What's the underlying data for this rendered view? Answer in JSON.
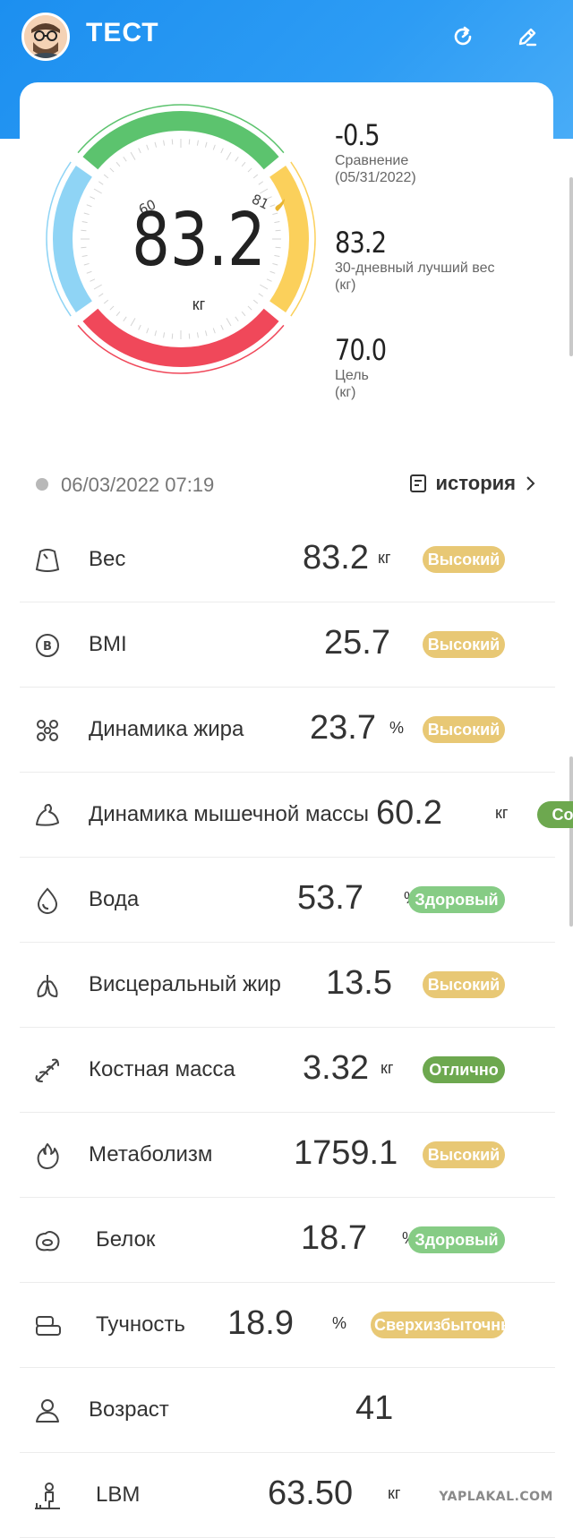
{
  "header": {
    "title": "ТЕСТ"
  },
  "gauge": {
    "weight": "83.2",
    "unit": "кг",
    "tick_low": "60",
    "tick_high": "81",
    "colors": {
      "green": "#5cc36e",
      "yellow": "#fbd05b",
      "red": "#f0485a",
      "blue": "#8fd4f5"
    }
  },
  "summary": [
    {
      "value": "-0.5",
      "label": "Сравнение",
      "sub": "(05/31/2022)"
    },
    {
      "value": "83.2",
      "label": "30-дневный лучший вес",
      "sub": "(кг)"
    },
    {
      "value": "70.0",
      "label": "Цель",
      "sub": "(кг)"
    }
  ],
  "record": {
    "datetime": "06/03/2022 07:19",
    "history_label": "история"
  },
  "metrics": [
    {
      "name": "Вес",
      "value": "83.2",
      "unit": "кг",
      "status": "Высокий",
      "status_color": "#e8c875",
      "icon": "scale-icon"
    },
    {
      "name": "BMI",
      "value": "25.7",
      "unit": "",
      "status": "Высокий",
      "status_color": "#e8c875",
      "icon": "bmi-icon"
    },
    {
      "name": "Динамика жира",
      "value": "23.7",
      "unit": "%",
      "status": "Высокий",
      "status_color": "#e8c875",
      "icon": "fat-icon"
    },
    {
      "name": "Динамика мышечной массы",
      "value": "60.2",
      "unit": "кг",
      "status": "Сов",
      "status_color": "#6da84f",
      "icon": "muscle-icon"
    },
    {
      "name": "Вода",
      "value": "53.7",
      "unit": "%",
      "status": "Здоровый",
      "status_color": "#86cc85",
      "icon": "water-icon"
    },
    {
      "name": "Висцеральный жир",
      "value": "13.5",
      "unit": "",
      "status": "Высокий",
      "status_color": "#e8c875",
      "icon": "lungs-icon"
    },
    {
      "name": "Костная масса",
      "value": "3.32",
      "unit": "кг",
      "status": "Отлично",
      "status_color": "#6da84f",
      "icon": "bone-icon"
    },
    {
      "name": "Метаболизм",
      "value": "1759.1",
      "unit": "",
      "status": "Высокий",
      "status_color": "#e8c875",
      "icon": "flame-icon"
    },
    {
      "name": "Белок",
      "value": "18.7",
      "unit": "%",
      "status": "Здоровый",
      "status_color": "#86cc85",
      "icon": "protein-icon"
    },
    {
      "name": "Тучность",
      "value": "18.9",
      "unit": "%",
      "status": "Сверхизбыточный",
      "status_color": "#e8c875",
      "icon": "obesity-icon"
    },
    {
      "name": "Возраст",
      "value": "41",
      "unit": "",
      "status": "",
      "status_color": "",
      "icon": "person-icon"
    },
    {
      "name": "LBM",
      "value": "63.50",
      "unit": "кг",
      "status": "",
      "status_color": "",
      "icon": "body-icon"
    }
  ],
  "watermark": "YAPLAKAL.COM"
}
